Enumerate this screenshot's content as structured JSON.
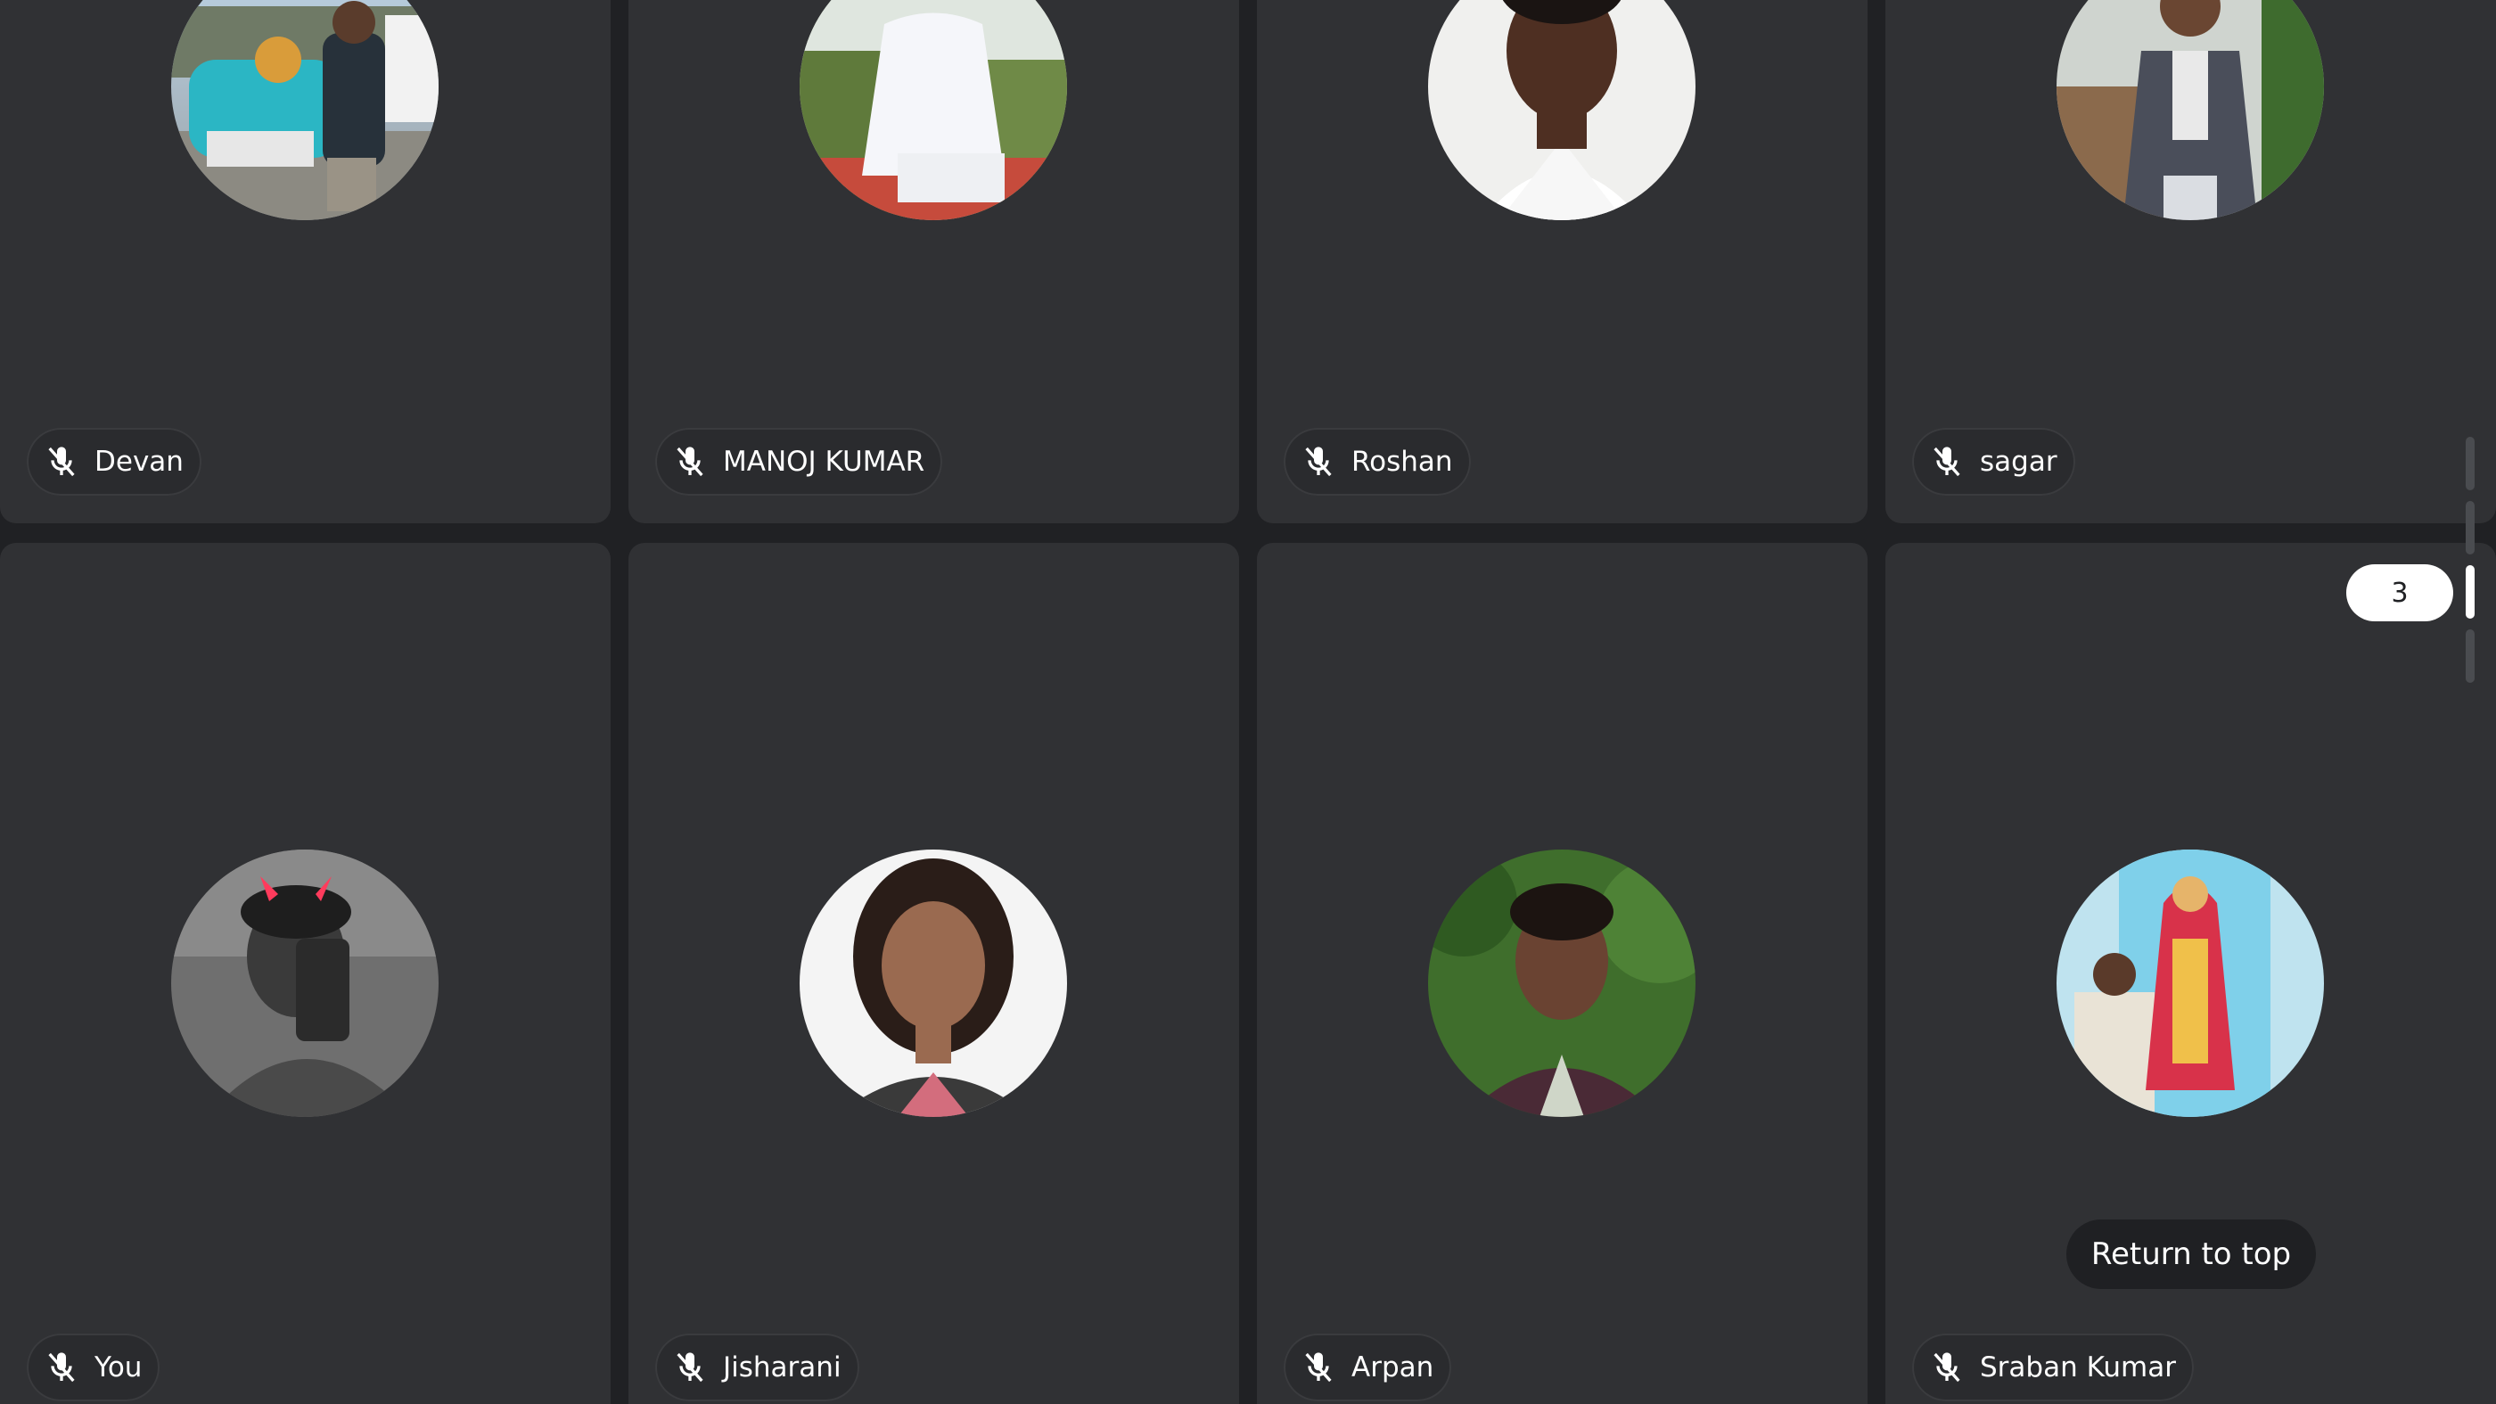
{
  "participants": [
    {
      "name": "Devan",
      "mic": "mic-off-icon",
      "avatar": "photo-man-with-car"
    },
    {
      "name": "MANOJ KUMAR",
      "mic": "mic-off-icon",
      "avatar": "photo-man-white-shirt"
    },
    {
      "name": "Roshan",
      "mic": "mic-off-icon",
      "avatar": "photo-man-portrait"
    },
    {
      "name": "sagar",
      "mic": "mic-off-icon",
      "avatar": "photo-man-blazer"
    },
    {
      "name": "You",
      "mic": "mic-off-icon",
      "avatar": "photo-selfie-devil-horns"
    },
    {
      "name": "Jisharani",
      "mic": "mic-off-icon",
      "avatar": "photo-woman-portrait"
    },
    {
      "name": "Arpan",
      "mic": "mic-off-icon",
      "avatar": "photo-man-greenery"
    },
    {
      "name": "Sraban Kumar",
      "mic": "mic-off-icon",
      "avatar": "photo-man-with-statue"
    }
  ],
  "return_to_top": "Return to top",
  "page_indicator": "3",
  "colors": {
    "background": "#202124",
    "tile": "#303134",
    "pill": "#2a2b2e",
    "text": "#ffffff"
  }
}
